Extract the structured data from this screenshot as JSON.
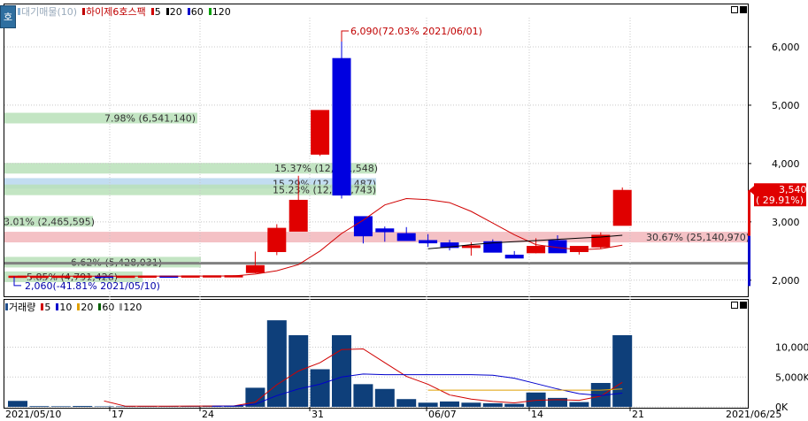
{
  "price_panel": {
    "legend": [
      {
        "label": "대기매물(10)",
        "color": "#8fb6d8"
      },
      {
        "label": "하이제6호스팩",
        "color": "#c00000"
      },
      {
        "label": "5",
        "color": "#d00000"
      },
      {
        "label": "20",
        "color": "#000000"
      },
      {
        "label": "60",
        "color": "#0000cc"
      },
      {
        "label": "120",
        "color": "#00a000"
      }
    ],
    "side_tab_label": "호",
    "y_ticks": [
      "6,000",
      "5,000",
      "4,000",
      "3,000",
      "2,000"
    ],
    "current_price": "3,540",
    "current_change": "( 29.91%)",
    "high_annotation": "6,090(72.03% 2021/06/01)",
    "low_annotation": "2,060(-41.81% 2021/05/10)",
    "volume_profile": [
      {
        "label": "7.98% (6,541,140)",
        "color": "#b9e0b9"
      },
      {
        "label": "15.37% (12,601,548)",
        "color": "#b9e0b9"
      },
      {
        "label": "15.29% (12,533,487)",
        "color": "#b7d7ee"
      },
      {
        "label": "15.23% (12,494,743)",
        "color": "#b9e0b9"
      },
      {
        "label": "3.01% (2,465,595)",
        "color": "#b9e0b9"
      },
      {
        "label": "30.67% (25,140,970)",
        "color": "#f2b6bb"
      },
      {
        "label": "6.62% (5,428,031)",
        "color": "#b9e0b9"
      },
      {
        "label": "5.85% (4,791,426)",
        "color": "#b9e0b9"
      }
    ]
  },
  "volume_panel": {
    "legend": [
      {
        "label": "거래량",
        "color": "#1f4e8c"
      },
      {
        "label": "5",
        "color": "#d00000"
      },
      {
        "label": "10",
        "color": "#0000cc"
      },
      {
        "label": "20",
        "color": "#e0a000"
      },
      {
        "label": "60",
        "color": "#006000"
      },
      {
        "label": "120",
        "color": "#999999"
      }
    ],
    "y_ticks": [
      "10,000K",
      "5,000K",
      "0K"
    ]
  },
  "x_axis": {
    "labels": [
      "2021/05/10",
      "17",
      "24",
      "31",
      "06/07",
      "14",
      "21",
      "2021/06/25"
    ]
  },
  "chart_data": {
    "type": "candlestick",
    "price_ylim": [
      1800,
      6500
    ],
    "volume_ylim_thousands": [
      0,
      16000
    ],
    "candles": [
      {
        "i": 0,
        "o": 2060,
        "h": 2075,
        "l": 2060,
        "c": 2070
      },
      {
        "i": 1,
        "o": 2065,
        "h": 2075,
        "l": 2060,
        "c": 2068
      },
      {
        "i": 2,
        "o": 2068,
        "h": 2075,
        "l": 2062,
        "c": 2070
      },
      {
        "i": 3,
        "o": 2070,
        "h": 2075,
        "l": 2065,
        "c": 2072
      },
      {
        "i": 4,
        "o": 2070,
        "h": 2075,
        "l": 2065,
        "c": 2068
      },
      {
        "i": 5,
        "o": 2068,
        "h": 2075,
        "l": 2063,
        "c": 2070
      },
      {
        "i": 6,
        "o": 2070,
        "h": 2075,
        "l": 2065,
        "c": 2072
      },
      {
        "i": 7,
        "o": 2072,
        "h": 2075,
        "l": 2066,
        "c": 2070
      },
      {
        "i": 8,
        "o": 2070,
        "h": 2080,
        "l": 2066,
        "c": 2074
      },
      {
        "i": 9,
        "o": 2074,
        "h": 2080,
        "l": 2068,
        "c": 2076
      },
      {
        "i": 10,
        "o": 2076,
        "h": 2085,
        "l": 2070,
        "c": 2078
      },
      {
        "i": 11,
        "o": 2130,
        "h": 2490,
        "l": 2120,
        "c": 2250
      },
      {
        "i": 12,
        "o": 2490,
        "h": 2960,
        "l": 2430,
        "c": 2890
      },
      {
        "i": 13,
        "o": 2840,
        "h": 3790,
        "l": 2840,
        "c": 3370
      },
      {
        "i": 14,
        "o": 4160,
        "h": 4900,
        "l": 4130,
        "c": 4910
      },
      {
        "i": 15,
        "o": 5800,
        "h": 6090,
        "l": 3400,
        "c": 3460
      },
      {
        "i": 16,
        "o": 3090,
        "h": 3090,
        "l": 2630,
        "c": 2760
      },
      {
        "i": 17,
        "o": 2880,
        "h": 2920,
        "l": 2660,
        "c": 2830
      },
      {
        "i": 18,
        "o": 2800,
        "h": 2910,
        "l": 2680,
        "c": 2680
      },
      {
        "i": 19,
        "o": 2680,
        "h": 2790,
        "l": 2570,
        "c": 2640
      },
      {
        "i": 20,
        "o": 2640,
        "h": 2690,
        "l": 2510,
        "c": 2560
      },
      {
        "i": 21,
        "o": 2560,
        "h": 2650,
        "l": 2420,
        "c": 2590
      },
      {
        "i": 22,
        "o": 2660,
        "h": 2700,
        "l": 2480,
        "c": 2480
      },
      {
        "i": 23,
        "o": 2430,
        "h": 2500,
        "l": 2390,
        "c": 2380
      },
      {
        "i": 24,
        "o": 2470,
        "h": 2720,
        "l": 2460,
        "c": 2580
      },
      {
        "i": 25,
        "o": 2680,
        "h": 2770,
        "l": 2470,
        "c": 2470
      },
      {
        "i": 26,
        "o": 2490,
        "h": 2580,
        "l": 2440,
        "c": 2580
      },
      {
        "i": 27,
        "o": 2570,
        "h": 2820,
        "l": 2540,
        "c": 2770
      },
      {
        "i": 28,
        "o": 2940,
        "h": 3590,
        "l": 2940,
        "c": 3540
      }
    ],
    "ma5": [
      2070,
      2069,
      2069,
      2070,
      2070,
      2070,
      2071,
      2070,
      2071,
      2072,
      2073,
      2105,
      2163,
      2267,
      2500,
      2800,
      3030,
      3290,
      3400,
      3380,
      3330,
      3180,
      2980,
      2780,
      2610,
      2560,
      2520,
      2540,
      2600
    ],
    "ma20": [
      null,
      null,
      null,
      null,
      null,
      null,
      null,
      null,
      null,
      null,
      null,
      null,
      null,
      null,
      null,
      null,
      null,
      null,
      null,
      2540,
      2570,
      2610,
      2640,
      2660,
      2680,
      2700,
      2720,
      2740,
      2770
    ],
    "volume_thousands": [
      1000,
      120,
      100,
      150,
      80,
      80,
      100,
      120,
      150,
      200,
      200,
      3200,
      14500,
      12000,
      6300,
      12000,
      3800,
      3000,
      1300,
      700,
      900,
      700,
      600,
      500,
      2400,
      1500,
      800,
      4000,
      12000
    ],
    "vol_ma5": [
      null,
      null,
      null,
      null,
      1000,
      100,
      100,
      110,
      130,
      130,
      150,
      780,
      3700,
      6000,
      7400,
      9600,
      9700,
      7400,
      5100,
      3800,
      2000,
      1300,
      900,
      660,
      1100,
      1200,
      1100,
      1800,
      4100
    ],
    "vol_ma10": [
      null,
      null,
      null,
      null,
      null,
      null,
      null,
      null,
      null,
      120,
      140,
      440,
      1880,
      3000,
      3800,
      5000,
      5500,
      5400,
      5400,
      5400,
      5400,
      5400,
      5300,
      4800,
      3900,
      3000,
      2200,
      1900,
      2300
    ],
    "vol_ma20": [
      null,
      null,
      null,
      null,
      null,
      null,
      null,
      null,
      null,
      null,
      null,
      null,
      null,
      null,
      null,
      null,
      null,
      null,
      null,
      2800,
      2800,
      2800,
      2800,
      2800,
      2800,
      2800,
      2800,
      2800,
      3000
    ]
  }
}
